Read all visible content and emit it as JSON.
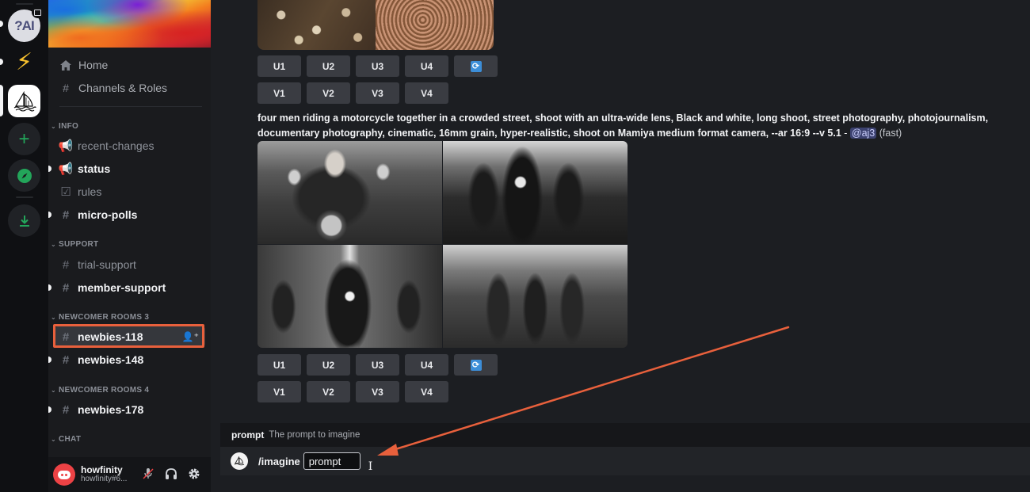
{
  "servers": [
    {
      "name": "ai-server",
      "label": "?AI",
      "unread": true,
      "has_event_badge": true
    },
    {
      "name": "lightning-server",
      "label": "⚡",
      "unread": true
    },
    {
      "name": "midjourney-server",
      "label": "Midjourney",
      "selected": true
    },
    {
      "name": "add-server",
      "label": "+"
    },
    {
      "name": "explore-servers",
      "label": "Explore"
    },
    {
      "name": "download-apps",
      "label": "Download"
    }
  ],
  "sidebar": {
    "nav": [
      {
        "label": "Home",
        "icon": "home-icon"
      },
      {
        "label": "Channels & Roles",
        "icon": "channels-roles-icon"
      }
    ],
    "categories": [
      {
        "label": "INFO",
        "channels": [
          {
            "label": "recent-changes",
            "icon": "announcement-icon",
            "unread": false
          },
          {
            "label": "status",
            "icon": "announcement-icon",
            "unread": true
          },
          {
            "label": "rules",
            "icon": "rules-icon",
            "unread": false
          },
          {
            "label": "micro-polls",
            "icon": "hashtag-locked-icon",
            "unread": true
          }
        ]
      },
      {
        "label": "SUPPORT",
        "channels": [
          {
            "label": "trial-support",
            "icon": "hashtag-icon",
            "unread": false
          },
          {
            "label": "member-support",
            "icon": "hashtag-locked-icon",
            "unread": true
          }
        ]
      },
      {
        "label": "NEWCOMER ROOMS 3",
        "channels": [
          {
            "label": "newbies-118",
            "icon": "hashtag-thread-icon",
            "selected": true,
            "highlighted": true
          },
          {
            "label": "newbies-148",
            "icon": "hashtag-thread-icon",
            "unread": true
          }
        ]
      },
      {
        "label": "NEWCOMER ROOMS 4",
        "channels": [
          {
            "label": "newbies-178",
            "icon": "hashtag-thread-icon",
            "unread": true
          }
        ]
      },
      {
        "label": "CHAT",
        "channels": []
      }
    ],
    "user": {
      "name": "howfinity",
      "tag": "howfinity#6..."
    }
  },
  "messages": {
    "first_buttons": {
      "upscale": [
        "U1",
        "U2",
        "U3",
        "U4"
      ],
      "variation": [
        "V1",
        "V2",
        "V3",
        "V4"
      ]
    },
    "prompt": {
      "text": "four men riding a motorcycle together in a crowded street, shoot with an ultra-wide lens, Black and white, long shoot, street photography, photojournalism, documentary photography, cinematic, 16mm grain, hyper-realistic, shoot on Mamiya medium format camera, --ar 16:9 --v 5.1",
      "separator": " - ",
      "mention": "@aj3",
      "mode": "(fast)"
    },
    "second_buttons": {
      "upscale": [
        "U1",
        "U2",
        "U3",
        "U4"
      ],
      "variation": [
        "V1",
        "V2",
        "V3",
        "V4"
      ]
    }
  },
  "composer": {
    "autocomplete_option": "prompt",
    "autocomplete_description": "The prompt to imagine",
    "command": "/imagine",
    "option_chip": "prompt"
  },
  "colors": {
    "annotation": "#e8603c",
    "accent_green": "#23a55a",
    "mention_bg": "#3c4270"
  }
}
